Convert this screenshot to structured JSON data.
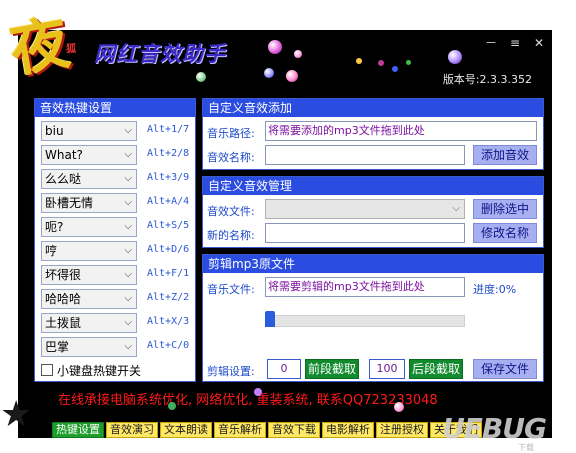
{
  "app": {
    "title": "网红音效助手",
    "logo_char": "夜",
    "logo_small": "狐",
    "version": "版本号:2.3.3.352",
    "window_buttons": [
      "－",
      "≡",
      "✕"
    ]
  },
  "hotkeys": {
    "header": "音效热键设置",
    "items": [
      {
        "value": "biu",
        "key": "Alt+1/7"
      },
      {
        "value": "What?",
        "key": "Alt+2/8"
      },
      {
        "value": "么么哒",
        "key": "Alt+3/9"
      },
      {
        "value": "卧槽无情",
        "key": "Alt+A/4"
      },
      {
        "value": "呃?",
        "key": "Alt+S/5"
      },
      {
        "value": "哼",
        "key": "Alt+D/6"
      },
      {
        "value": "坏得很",
        "key": "Alt+F/1"
      },
      {
        "value": "哈哈哈",
        "key": "Alt+Z/2"
      },
      {
        "value": "土拨鼠",
        "key": "Alt+X/3"
      },
      {
        "value": "巴掌",
        "key": "Alt+C/0"
      }
    ],
    "toggle_label": "小键盘热键开关",
    "toggle_checked": false
  },
  "add_effect": {
    "header": "自定义音效添加",
    "path_label": "音乐路径:",
    "path_value": "将需要添加的mp3文件拖到此处",
    "name_label": "音效名称:",
    "name_value": "",
    "add_button": "添加音效"
  },
  "manage_effect": {
    "header": "自定义音效管理",
    "file_label": "音效文件:",
    "file_value": "",
    "newname_label": "新的名称:",
    "newname_value": "",
    "delete_button": "删除选中",
    "rename_button": "修改名称"
  },
  "clip": {
    "header": "剪辑mp3原文件",
    "file_label": "音乐文件:",
    "file_value": "将需要剪辑的mp3文件拖到此处",
    "progress_label": "进度:0%",
    "progress": 0,
    "settings_label": "剪辑设置:",
    "start_value": "0",
    "start_button": "前段截取",
    "end_value": "100",
    "end_button": "后段截取",
    "save_button": "保存文件"
  },
  "marquee": "在线承接电脑系统优化, 网络优化, 重装系统, 联系QQ723233048",
  "tabs": [
    "热键设置",
    "音效演习",
    "文本朗读",
    "音乐解析",
    "音效下载",
    "电影解析",
    "注册授权",
    "关于我们"
  ],
  "active_tab": 0,
  "watermark": {
    "text": "UEBUG",
    "sub": "下载"
  },
  "colors": {
    "panel_header": "#2a4ce0",
    "label": "#1c49c9",
    "button": "#a6b0f0",
    "green_button": "#128a2e",
    "marquee": "#ff1a1a",
    "tab": "#ffe866",
    "tab_active": "#1f9e2e"
  }
}
